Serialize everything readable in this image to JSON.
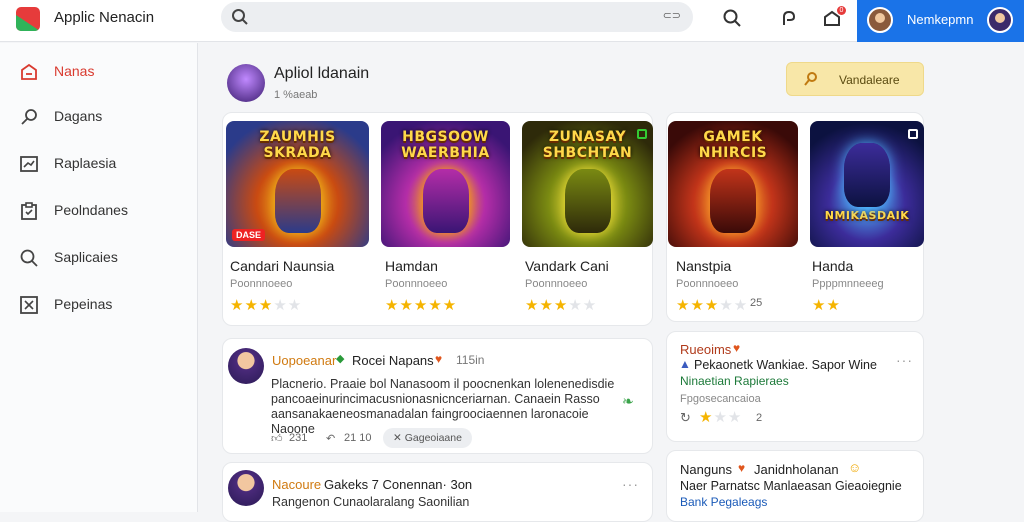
{
  "app": {
    "title": "Applic Nenacin"
  },
  "search": {
    "placeholder": "",
    "value": ""
  },
  "topbar": {
    "notification_count": "0",
    "user_name": "Nemkepmn"
  },
  "sidebar": {
    "items": [
      {
        "label": "Nanas",
        "icon": "home-icon",
        "active": true
      },
      {
        "label": "Dagans",
        "icon": "search-icon"
      },
      {
        "label": "Raplaesia",
        "icon": "chart-icon"
      },
      {
        "label": "Peolndanes",
        "icon": "clipboard-icon"
      },
      {
        "label": "Saplicaies",
        "icon": "magnifier-icon"
      },
      {
        "label": "Pepeinas",
        "icon": "grid-icon"
      }
    ]
  },
  "featured": {
    "title": "Apliol ldanain",
    "subtitle": "1 %aeab",
    "button_label": "Vandaleare",
    "games": [
      {
        "art_title": "ZAUMHIS SKRADA",
        "name": "Candari Naunsia",
        "meta": "Poonnnoeeo",
        "rating": 3,
        "badge": "DASE",
        "colors": [
          "#2b3b8a",
          "#c94a12",
          "#f6c21a"
        ]
      },
      {
        "art_title": "HBGSOOW WAERBHIA",
        "name": "Hamdan",
        "meta": "Poonnnoeeo",
        "rating": 5,
        "colors": [
          "#3a1574",
          "#b42da8",
          "#ffb000"
        ]
      },
      {
        "art_title": "ZUNASAY SHBCHTAN",
        "name": "Vandark Cani",
        "meta": "Poonnnoeeo",
        "rating": 3,
        "colors": [
          "#2e2a0a",
          "#7a8a12",
          "#f3e23a"
        ]
      },
      {
        "art_title": "GAMEK NHIRCIS",
        "name": "Nanstpia",
        "meta": "Poonnnoeeo",
        "rating": 3,
        "rating_text": "25",
        "colors": [
          "#3a0a08",
          "#c2341a",
          "#ffa62b"
        ]
      },
      {
        "art_title": "NMIKASDAIK",
        "name": "Handa",
        "meta": "Ppppmnneeeg",
        "rating": 2,
        "colors": [
          "#0c1240",
          "#3c2c9a",
          "#4fb8ff"
        ]
      }
    ]
  },
  "posts": [
    {
      "user": "Uopoeanar",
      "head": "Rocei  Napans",
      "time": "115in",
      "body": [
        "Placnerio. Praaie bol  Nanasoom il poocnenkan lolenenedisdie",
        "pancoaeinurincimacusnionasnicnceriarnan. Canaein Rasso",
        "aansanakaeneosmanadalan faingroociaennen laronacoie Naoone"
      ],
      "likes": "231",
      "comments": "21 10",
      "tag": "Gageoiaane"
    },
    {
      "user": "Nacoure",
      "head": "Gakeks  7  Conennan· 3on",
      "body_line": "Rangenon Cunaolaralang Saonilian"
    }
  ],
  "side_cards": [
    {
      "title": "Rueoims",
      "line": "Pekaonetk Wankiae. Sapor Wine",
      "link": "Ninaetian Rapieraes",
      "meta": "Fpgosecancaioa",
      "rating": 1,
      "rating_text": "2"
    },
    {
      "title": "Nanguns",
      "title_rest": "Janidnholanan",
      "line": "Naer Parnatsc Manlaeasan Gieaoiegnie",
      "link": "Bank  Pegaleags"
    }
  ],
  "colors": {
    "accent": "#1a73e8",
    "active": "#d93a2f",
    "star": "#f5b400"
  }
}
